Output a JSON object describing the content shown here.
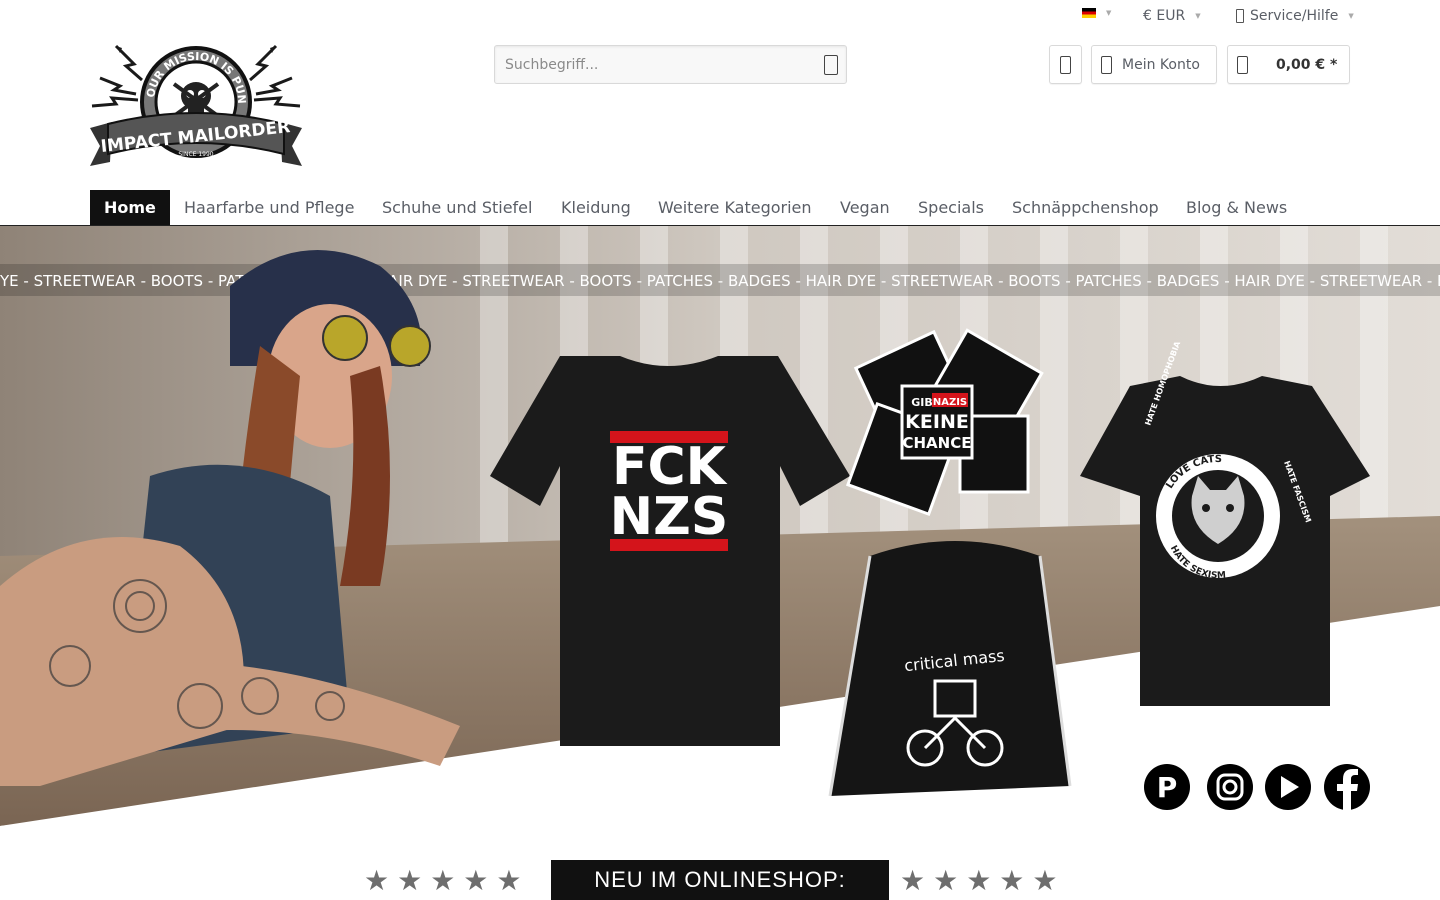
{
  "topbar": {
    "language_icon": "german-flag-icon",
    "currency": "€ EUR",
    "service": "Service/Hilfe"
  },
  "brand": {
    "logo_text": "IMPACT MAILORDER",
    "logo_tagline": "OUR MISSION IS PUNKROCK",
    "logo_since": "SINCE 1990"
  },
  "search": {
    "placeholder": "Suchbegriff...",
    "icon": "search-icon"
  },
  "header": {
    "notes_icon": "heart-icon",
    "account_label": "Mein Konto",
    "cart_total": "0,00 € *"
  },
  "nav": {
    "items": [
      {
        "label": "Home",
        "active": true
      },
      {
        "label": "Haarfarbe und Pflege"
      },
      {
        "label": "Schuhe und Stiefel"
      },
      {
        "label": "Kleidung"
      },
      {
        "label": "Weitere Kategorien"
      },
      {
        "label": "Vegan"
      },
      {
        "label": "Specials"
      },
      {
        "label": "Schnäppchenshop"
      },
      {
        "label": "Blog & News"
      }
    ]
  },
  "hero": {
    "ticker": "YE - STREETWEAR - BOOTS - PATCHES - BADGES - HAIR DYE - STREETWEAR - BOOTS - PATCHES - BADGES - HAIR DYE - STREETWEAR - BOOTS - PATCHES - BADGES - HAIR DYE - STREETWEAR - BO",
    "shirt_line1": "FCK",
    "shirt_line2": "NZS",
    "patch_top": "GIB",
    "patch_red": "NAZIS",
    "patch_mid": "KEINE",
    "patch_bottom": "CHANCE",
    "bag_text": "critical mass",
    "cat_shirt_top": "LOVE CATS",
    "cat_shirt_right": "HATE FASCISM",
    "cat_shirt_bottom": "HATE SEXISM",
    "cat_shirt_left": "HATE HOMOPHOBIA",
    "socials": [
      "pinterest-icon",
      "instagram-icon",
      "youtube-icon",
      "facebook-icon"
    ],
    "banner": "NEU IM ONLINESHOP:"
  }
}
